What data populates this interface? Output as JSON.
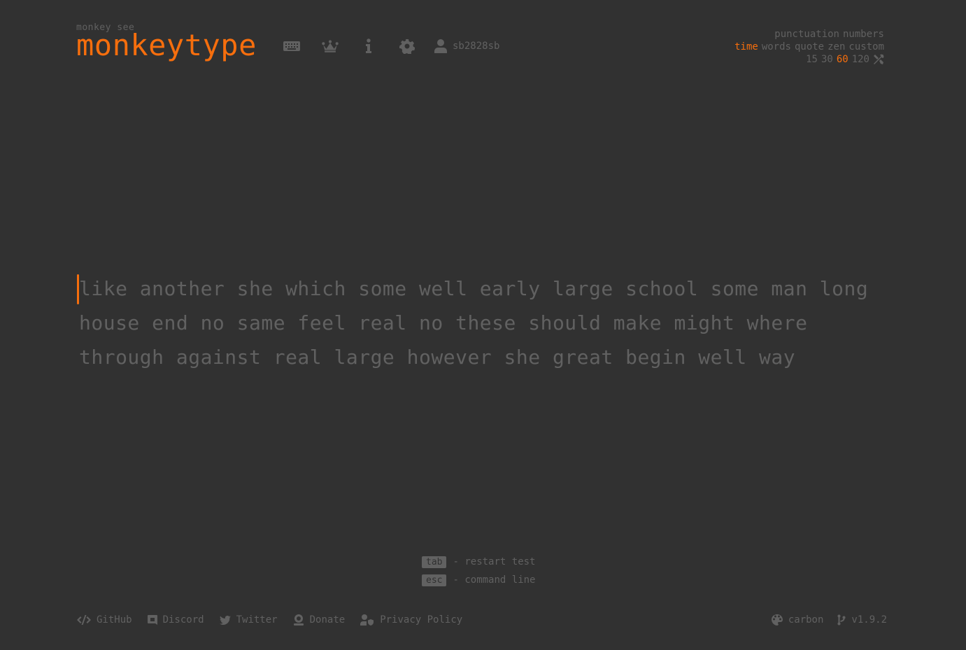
{
  "logo": {
    "subtitle": "monkey see",
    "title": "monkeytype"
  },
  "nav": {
    "icons": [
      "keyboard-icon",
      "crown-icon",
      "info-icon",
      "gear-icon",
      "user-icon"
    ],
    "username": "sb2828sb"
  },
  "config": {
    "toggles": [
      "punctuation",
      "numbers"
    ],
    "modes": [
      "time",
      "words",
      "quote",
      "zen",
      "custom"
    ],
    "active_mode": "time",
    "durations": [
      "15",
      "30",
      "60",
      "120"
    ],
    "active_duration": "60"
  },
  "words": {
    "lines": [
      "like another she which some well early large school some man long",
      "house end no same feel real no these should make might where",
      "through against real large however she great begin well way"
    ]
  },
  "hints": [
    {
      "key": "tab",
      "text": "- restart test"
    },
    {
      "key": "esc",
      "text": "- command line"
    }
  ],
  "footer": {
    "links": [
      "GitHub",
      "Discord",
      "Twitter",
      "Donate",
      "Privacy Policy"
    ],
    "theme": "carbon",
    "version": "v1.9.2"
  },
  "colors": {
    "background": "#313131",
    "accent": "#f66e0d",
    "sub": "#616161"
  }
}
